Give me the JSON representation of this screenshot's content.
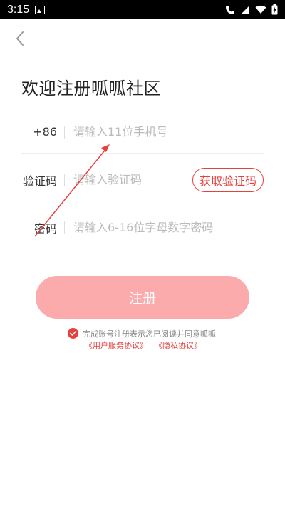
{
  "status_bar": {
    "time": "3:15",
    "icons": [
      "image-icon",
      "call-icon",
      "signal-icon",
      "wifi-icon",
      "battery-icon"
    ]
  },
  "nav": {
    "back_icon": "chevron-left-icon"
  },
  "page": {
    "title": "欢迎注册呱呱社区"
  },
  "form": {
    "phone": {
      "prefix": "+86",
      "placeholder": "请输入11位手机号",
      "value": ""
    },
    "code": {
      "label": "验证码",
      "placeholder": "请输入验证码",
      "value": "",
      "get_code_label": "获取验证码"
    },
    "password": {
      "label": "密码",
      "placeholder": "请输入6-16位字母数字密码",
      "value": ""
    }
  },
  "register_button": {
    "label": "注册"
  },
  "agreement": {
    "checked": true,
    "text": "完成账号注册表示您已阅读并同意呱呱",
    "user_agreement": "《用户服务协议》",
    "privacy_policy": "《隐私协议》"
  },
  "colors": {
    "accent": "#e5413d",
    "register_button_bg": "#fbabab",
    "annotation_arrow": "#e5413d"
  }
}
